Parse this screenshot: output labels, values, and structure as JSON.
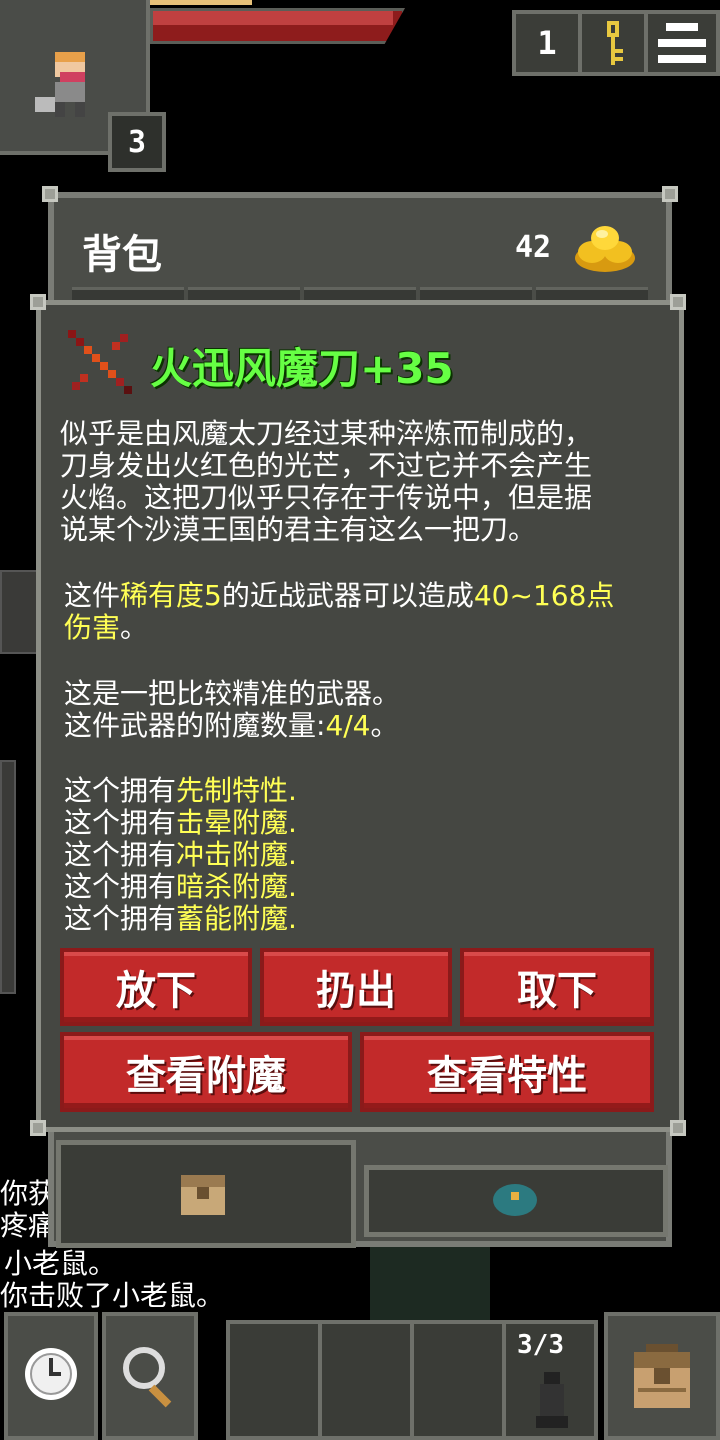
{
  "hud": {
    "depth": "3",
    "keys_count": "1",
    "colors": {
      "hp": "#c04040",
      "xp": "#e8c27a"
    }
  },
  "bag": {
    "title": "背包",
    "gold": "42",
    "icons": [
      "gold-pile-icon",
      "backpack-icon",
      "seed-icon"
    ]
  },
  "item": {
    "name": "火迅风魔刀+35",
    "icon": "sword-icon",
    "name_color": "#66ff44",
    "description_lines": [
      "似乎是由风魔太刀经过某种淬炼而制成的，",
      "刀身发出火红色的光芒，不过它并不会产生",
      "火焰。这把刀似乎只存在于传说中，但是据",
      "说某个沙漠王国的君主有这么一把刀。"
    ],
    "stats": {
      "p1": "这件",
      "rarity": "稀有度5",
      "p2": "的近战武器可以造成",
      "damage": "40~168点",
      "p3": "伤害",
      "p4": "。"
    },
    "accuracy_line": "这是一把比较精准的武器。",
    "enchant_count": {
      "prefix": "这件武器的附魔数量:",
      "value": "4/4",
      "suffix": "。"
    },
    "traits": [
      {
        "prefix": "这个拥有",
        "name": "先制特性",
        "suffix": "."
      },
      {
        "prefix": "这个拥有",
        "name": "击晕附魔",
        "suffix": "."
      },
      {
        "prefix": "这个拥有",
        "name": "冲击附魔",
        "suffix": "."
      },
      {
        "prefix": "这个拥有",
        "name": "暗杀附魔",
        "suffix": "."
      },
      {
        "prefix": "这个拥有",
        "name": "蓄能附魔",
        "suffix": "."
      }
    ],
    "buttons": {
      "drop": "放下",
      "throw": "扔出",
      "unequip": "取下",
      "view_enchant": "查看附魔",
      "view_traits": "查看特性"
    }
  },
  "log": {
    "lines": [
      "你获",
      "疼痛",
      "小老鼠。",
      "你击败了小老鼠。"
    ]
  },
  "toolbar": {
    "quickslot_count": "3/3",
    "icons": [
      "clock-icon",
      "search-icon",
      "backpack-icon"
    ]
  }
}
